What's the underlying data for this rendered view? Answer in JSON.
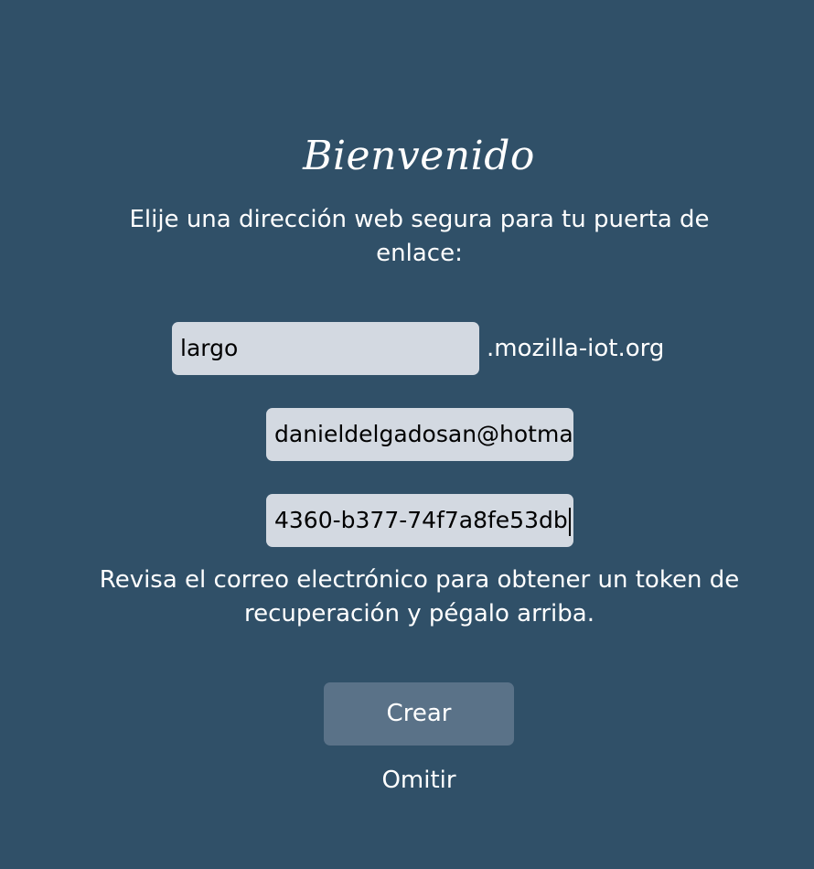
{
  "welcome": {
    "title": "Bienvenido",
    "intro": "Elije una dirección web segura para tu puerta de enlace:",
    "subdomain_value": "largo",
    "domain_suffix": ".mozilla-iot.org",
    "email_value": "danieldelgadosan@hotma",
    "token_value": "4360-b377-74f7a8fe53db",
    "hint": "Revisa el correo electrónico para obtener un token de recuperación y pégalo arriba.",
    "create_label": "Crear",
    "skip_label": "Omitir"
  },
  "colors": {
    "background": "#305068",
    "input_background": "#d3d9e1",
    "button_background": "#5a7288",
    "text": "#ffffff"
  }
}
